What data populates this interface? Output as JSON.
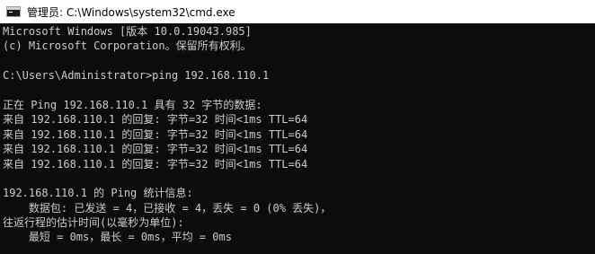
{
  "window": {
    "title": "管理员: C:\\Windows\\system32\\cmd.exe",
    "icon": "cmd-console-icon"
  },
  "console": {
    "lines": [
      "Microsoft Windows [版本 10.0.19043.985]",
      "(c) Microsoft Corporation。保留所有权利。",
      "",
      "C:\\Users\\Administrator>ping 192.168.110.1",
      "",
      "正在 Ping 192.168.110.1 具有 32 字节的数据:",
      "来自 192.168.110.1 的回复: 字节=32 时间<1ms TTL=64",
      "来自 192.168.110.1 的回复: 字节=32 时间<1ms TTL=64",
      "来自 192.168.110.1 的回复: 字节=32 时间<1ms TTL=64",
      "来自 192.168.110.1 的回复: 字节=32 时间<1ms TTL=64",
      "",
      "192.168.110.1 的 Ping 统计信息:",
      "    数据包: 已发送 = 4，已接收 = 4，丢失 = 0 (0% 丢失)，",
      "往返行程的估计时间(以毫秒为单位):",
      "    最短 = 0ms，最长 = 0ms，平均 = 0ms"
    ]
  },
  "colors": {
    "background": "#0c0c0c",
    "text": "#cccccc",
    "titlebar": "#ffffff"
  }
}
